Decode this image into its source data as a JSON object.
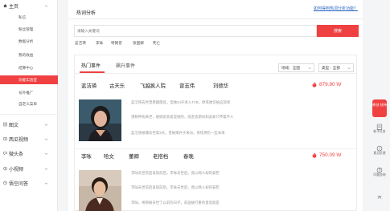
{
  "sidebar": {
    "home": {
      "label": "主页",
      "icon": "home-icon"
    },
    "home_items": [
      "私信",
      "粉丝管理",
      "数据分析",
      "我的收益",
      "结算中心",
      "功能实验室",
      "号外推广",
      "自定义菜单"
    ],
    "active_item": "功能实验室",
    "groups": [
      {
        "label": "图文",
        "icon": "article-icon"
      },
      {
        "label": "西瓜视频",
        "icon": "video-icon"
      },
      {
        "label": "微头条",
        "icon": "microheadline-icon"
      },
      {
        "label": "小视频",
        "icon": "short-video-icon"
      },
      {
        "label": "悟空问答",
        "icon": "qa-icon"
      }
    ]
  },
  "main": {
    "title": "热词分析",
    "help_link": "如何得到热词分析功能？",
    "search": {
      "placeholder": "请输入关键词",
      "button": "搜索"
    },
    "tags": [
      "蓝洁瑛",
      "李咏",
      "特朗普",
      "张国娜",
      "死亡"
    ],
    "tabs": [
      "热门事件",
      "飙升事件"
    ],
    "filters": {
      "region": "地域：全国",
      "type": "类型：全部"
    },
    "events": [
      {
        "names": [
          "蓝洁瑛",
          "古天乐",
          "飞越疯人院",
          "曾志伟",
          "刘德华"
        ],
        "heat": "879.80 W",
        "news": [
          "蓝洁瑛去世曾患躁郁症，但她24岁进入TVB，原来她仅拍这部戏",
          "患精神病离世，被她说会爱是她的，成金会期间如此却只怀着坏人",
          "蓝洁瑛被爆去世第3天，曾被揭开于采访，奇怪瑛仍一些本来"
        ]
      },
      {
        "names": [
          "李咏",
          "哈文",
          "董卿",
          "老搭档",
          "春晚"
        ],
        "heat": "750.09 W",
        "news": [
          "李咏去世前后发现前后，李咏去世后，竟以两人却的安慰",
          "李咏去世前后发现前后，李咏去世后，竟以两人却的安慰",
          "李咏，将那被去世了以前的日子，前面被打重的意思就是"
        ]
      }
    ]
  },
  "floatbar": {
    "badge": "原创 扶持",
    "buttons": [
      "新手任务",
      "意见反馈",
      "问题咨询"
    ]
  },
  "colors": {
    "accent": "#f04142",
    "link": "#2a64c5"
  }
}
